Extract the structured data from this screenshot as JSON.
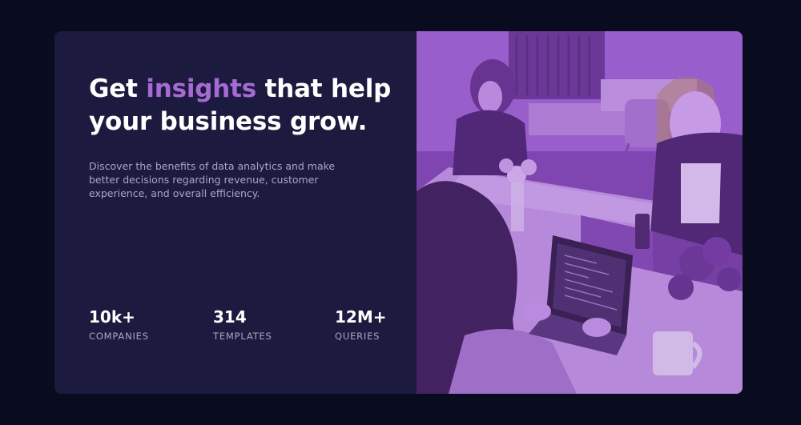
{
  "hero": {
    "headline_before": "Get ",
    "headline_accent": "insights",
    "headline_after": " that help your business grow.",
    "description": "Discover the benefits of data analytics and make better decisions regarding revenue, customer experience, and overall efficiency.",
    "image_subject": "people-working-photo"
  },
  "stats": [
    {
      "value": "10k+",
      "label": "COMPANIES"
    },
    {
      "value": "314",
      "label": "TEMPLATES"
    },
    {
      "value": "12M+",
      "label": "QUERIES"
    }
  ],
  "colors": {
    "page_background": "#090b1e",
    "card_background": "#1c1a3e",
    "accent": "#a66bd3",
    "text_muted": "#a9a6c4",
    "photo_tint": "#8f52c4"
  }
}
